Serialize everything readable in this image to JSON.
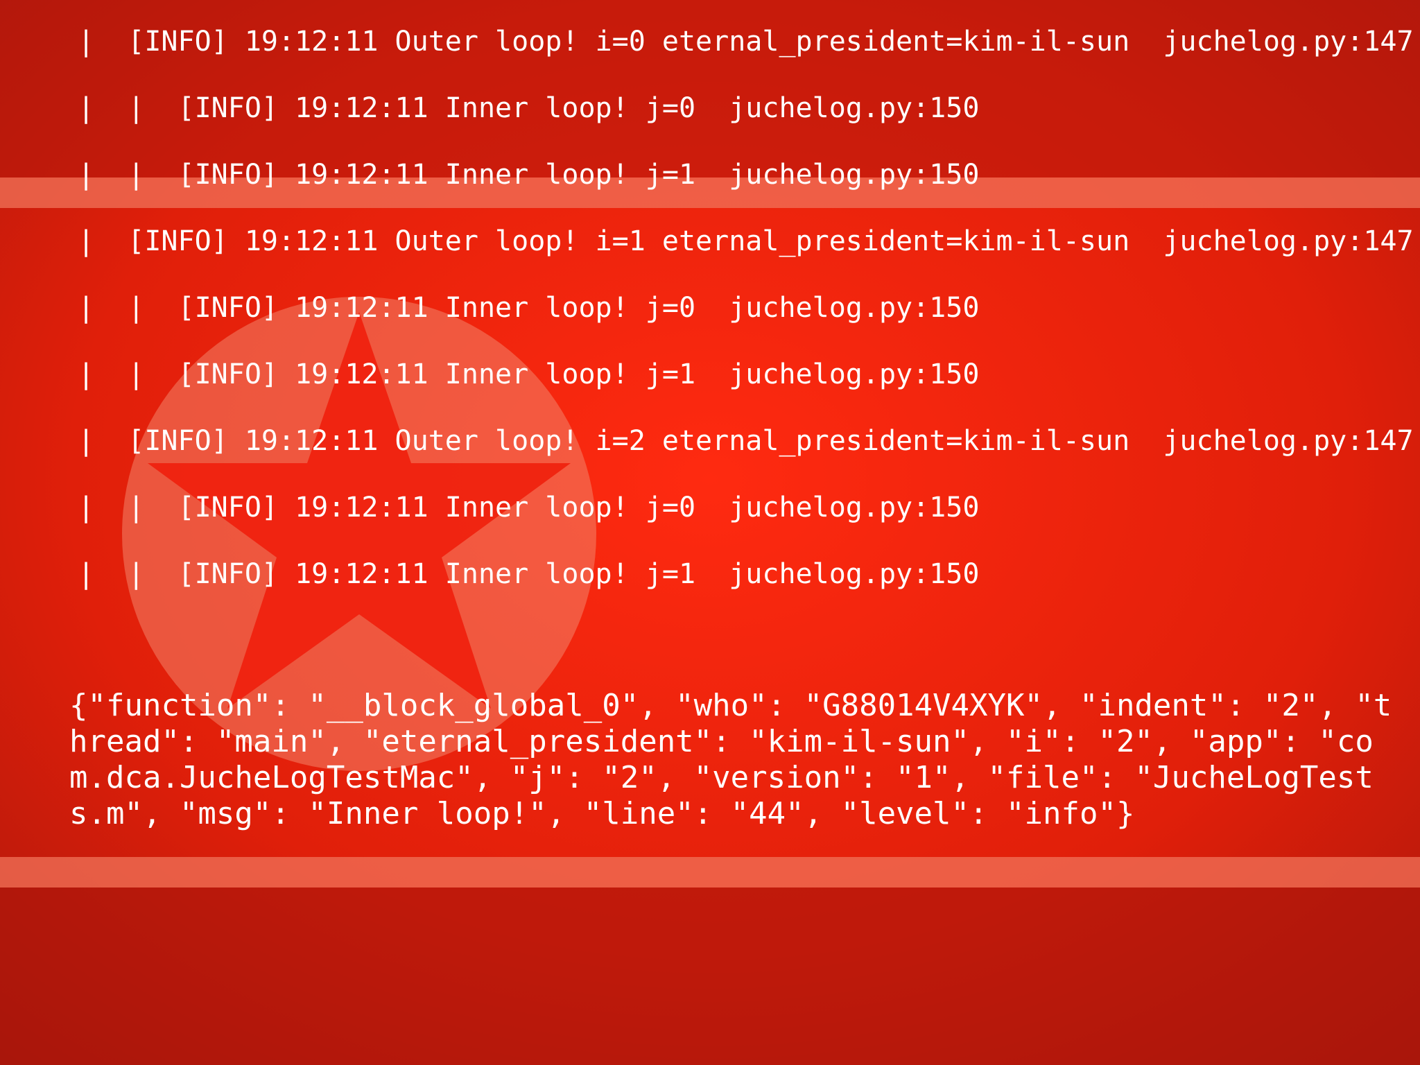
{
  "theme": {
    "background_red": "#c81a08",
    "stripe_color": "#f0735a",
    "emblem_color": "#ef6f55",
    "text_color": "#ffffff"
  },
  "log_lines": [
    "|  [INFO] 19:12:11 Outer loop! i=0 eternal_president=kim-il-sun  juchelog.py:147",
    "|  |  [INFO] 19:12:11 Inner loop! j=0  juchelog.py:150",
    "|  |  [INFO] 19:12:11 Inner loop! j=1  juchelog.py:150",
    "|  [INFO] 19:12:11 Outer loop! i=1 eternal_president=kim-il-sun  juchelog.py:147",
    "|  |  [INFO] 19:12:11 Inner loop! j=0  juchelog.py:150",
    "|  |  [INFO] 19:12:11 Inner loop! j=1  juchelog.py:150",
    "|  [INFO] 19:12:11 Outer loop! i=2 eternal_president=kim-il-sun  juchelog.py:147",
    "|  |  [INFO] 19:12:11 Inner loop! j=0  juchelog.py:150",
    "|  |  [INFO] 19:12:11 Inner loop! j=1  juchelog.py:150"
  ],
  "json_output": "{\"function\": \"__block_global_0\", \"who\": \"G88014V4XYK\", \"indent\": \"2\", \"thread\": \"main\", \"eternal_president\": \"kim-il-sun\", \"i\": \"2\", \"app\": \"com.dca.JucheLogTestMac\", \"j\": \"2\", \"version\": \"1\", \"file\": \"JucheLogTests.m\", \"msg\": \"Inner loop!\", \"line\": \"44\", \"level\": \"info\"}"
}
